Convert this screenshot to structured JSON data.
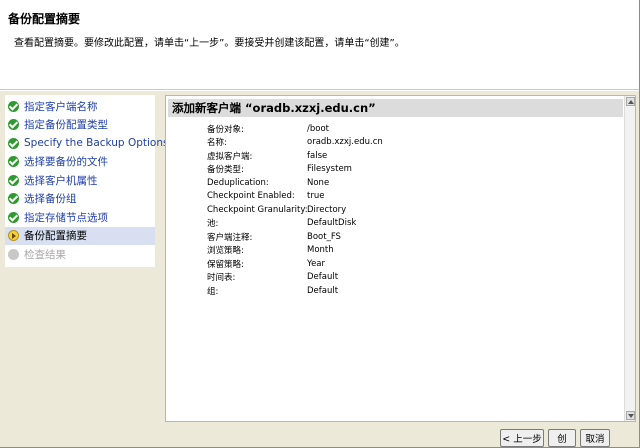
{
  "header": {
    "title": "备份配置摘要",
    "subtitle": "查看配置摘要。要修改此配置，请单击“上一步”。要接受并创建该配置，请单击“创建”。"
  },
  "steps": [
    {
      "label": "指定客户端名称",
      "status": "done"
    },
    {
      "label": "指定备份配置类型",
      "status": "done"
    },
    {
      "label": "Specify the Backup Options",
      "status": "done"
    },
    {
      "label": "选择要备份的文件",
      "status": "done"
    },
    {
      "label": "选择客户机属性",
      "status": "done"
    },
    {
      "label": "选择备份组",
      "status": "done"
    },
    {
      "label": "指定存储节点选项",
      "status": "done"
    },
    {
      "label": "备份配置摘要",
      "status": "current"
    },
    {
      "label": "检查结果",
      "status": "pending"
    }
  ],
  "details": {
    "heading": "添加新客户端 “oradb.xzxj.edu.cn”",
    "rows": [
      {
        "key": "备份对象:",
        "value": "/boot"
      },
      {
        "key": "名称:",
        "value": "oradb.xzxj.edu.cn"
      },
      {
        "key": "虚拟客户端:",
        "value": "false"
      },
      {
        "key": "备份类型:",
        "value": "Filesystem"
      },
      {
        "key": "Deduplication:",
        "value": "None"
      },
      {
        "key": "Checkpoint Enabled:",
        "value": "true"
      },
      {
        "key": "Checkpoint Granularity:",
        "value": "Directory"
      },
      {
        "key": "池:",
        "value": "DefaultDisk"
      },
      {
        "key": "客户端注释:",
        "value": "Boot_FS"
      },
      {
        "key": "浏览策略:",
        "value": "Month"
      },
      {
        "key": "保留策略:",
        "value": "Year"
      },
      {
        "key": "时间表:",
        "value": "Default"
      },
      {
        "key": "组:",
        "value": "Default"
      }
    ]
  },
  "buttons": {
    "prev_label": "< 上一步",
    "next_label": "创",
    "cancel_label": "取消"
  }
}
